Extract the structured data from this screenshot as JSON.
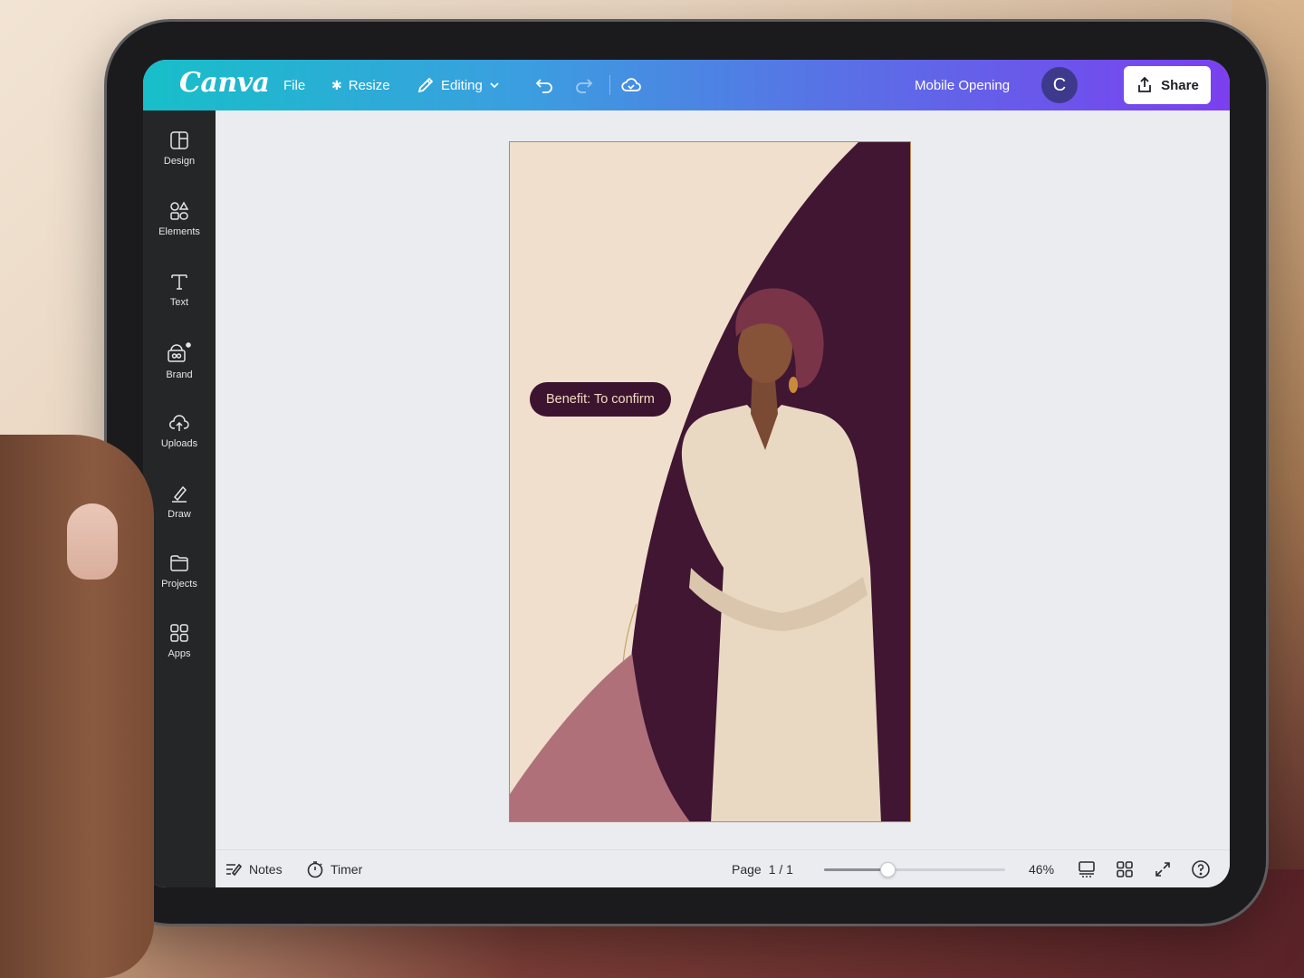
{
  "topbar": {
    "logo": "Canva",
    "file": "File",
    "resize": "Resize",
    "editing": "Editing",
    "title": "Mobile Opening",
    "avatar_initial": "C",
    "share": "Share"
  },
  "sidebar": {
    "items": [
      {
        "label": "Design",
        "icon": "design-icon"
      },
      {
        "label": "Elements",
        "icon": "elements-icon"
      },
      {
        "label": "Text",
        "icon": "text-icon"
      },
      {
        "label": "Brand",
        "icon": "brand-icon"
      },
      {
        "label": "Uploads",
        "icon": "uploads-icon"
      },
      {
        "label": "Draw",
        "icon": "draw-icon"
      },
      {
        "label": "Projects",
        "icon": "projects-icon"
      },
      {
        "label": "Apps",
        "icon": "apps-icon"
      }
    ]
  },
  "design": {
    "pill_text": "Benefit: To confirm"
  },
  "bottombar": {
    "notes": "Notes",
    "timer": "Timer",
    "page_label": "Page",
    "page_value": "1 / 1",
    "zoom": "46%",
    "zoom_fraction": 0.35
  },
  "colors": {
    "accent_start": "#17bfc9",
    "accent_end": "#7b3ff0",
    "sidebar": "#252627",
    "plum": "#3d1430",
    "rose": "#b0707a"
  }
}
